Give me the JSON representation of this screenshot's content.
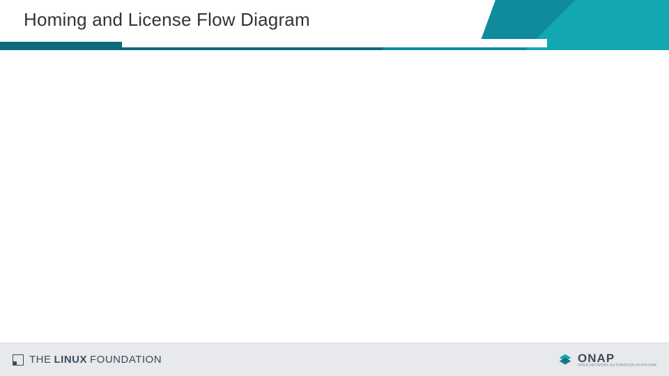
{
  "header": {
    "title": "Homing and License Flow Diagram"
  },
  "footer": {
    "left_logo": {
      "part_the": "THE",
      "part_linux": "LINUX",
      "part_foundation": "FOUNDATION",
      "icon_name": "linux-foundation-icon"
    },
    "right_logo": {
      "main": "ONAP",
      "tagline": "OPEN NETWORK AUTOMATION PLATFORM",
      "icon_name": "onap-icon"
    }
  }
}
